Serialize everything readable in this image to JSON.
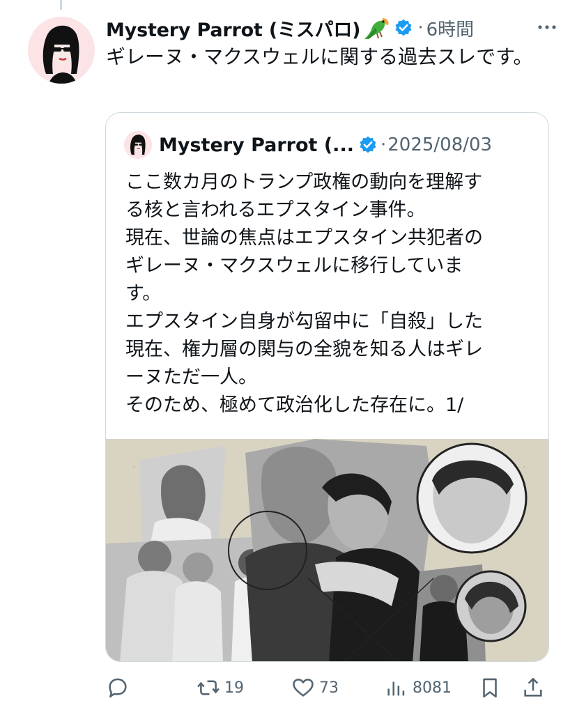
{
  "post": {
    "author": {
      "display_name": "Mystery Parrot (ミスパロ)",
      "icons": [
        "parrot-emoji-icon",
        "verified-badge-icon"
      ]
    },
    "time": "6時間",
    "separator": "·",
    "text": "ギレーヌ・マクスウェルに関する過去スレです。"
  },
  "quoted_post": {
    "author": {
      "display_name": "Mystery Parrot (...",
      "icons": [
        "verified-badge-icon"
      ]
    },
    "separator": "·",
    "date": "2025/08/03",
    "lines": [
      "ここ数カ月のトランプ政権の動向を理解す",
      "る核と言われるエプスタイン事件。",
      "現在、世論の焦点はエプスタイン共犯者の",
      "ギレーヌ・マクスウェルに移行していま",
      "す。",
      "エプスタイン自身が勾留中に「自殺」した",
      "現在、権力層の関与の全貌を知る人はギレ",
      "ーヌただ一人。",
      "そのため、極めて政治化した存在に。1/"
    ]
  },
  "actions": {
    "reply": {
      "icon": "reply-icon",
      "count": ""
    },
    "repost": {
      "icon": "repost-icon",
      "count": "19"
    },
    "like": {
      "icon": "heart-icon",
      "count": "73"
    },
    "views": {
      "icon": "analytics-icon",
      "count": "8081"
    },
    "bookmark": {
      "icon": "bookmark-icon",
      "count": ""
    },
    "share": {
      "icon": "share-icon",
      "count": ""
    }
  },
  "colors": {
    "text_primary": "#0f1419",
    "text_secondary": "#536471",
    "verified": "#1d9bf0",
    "border": "#cfd9de",
    "avatar_bg": "#fbe3e6",
    "collage_bg": "#d9d3c2"
  }
}
